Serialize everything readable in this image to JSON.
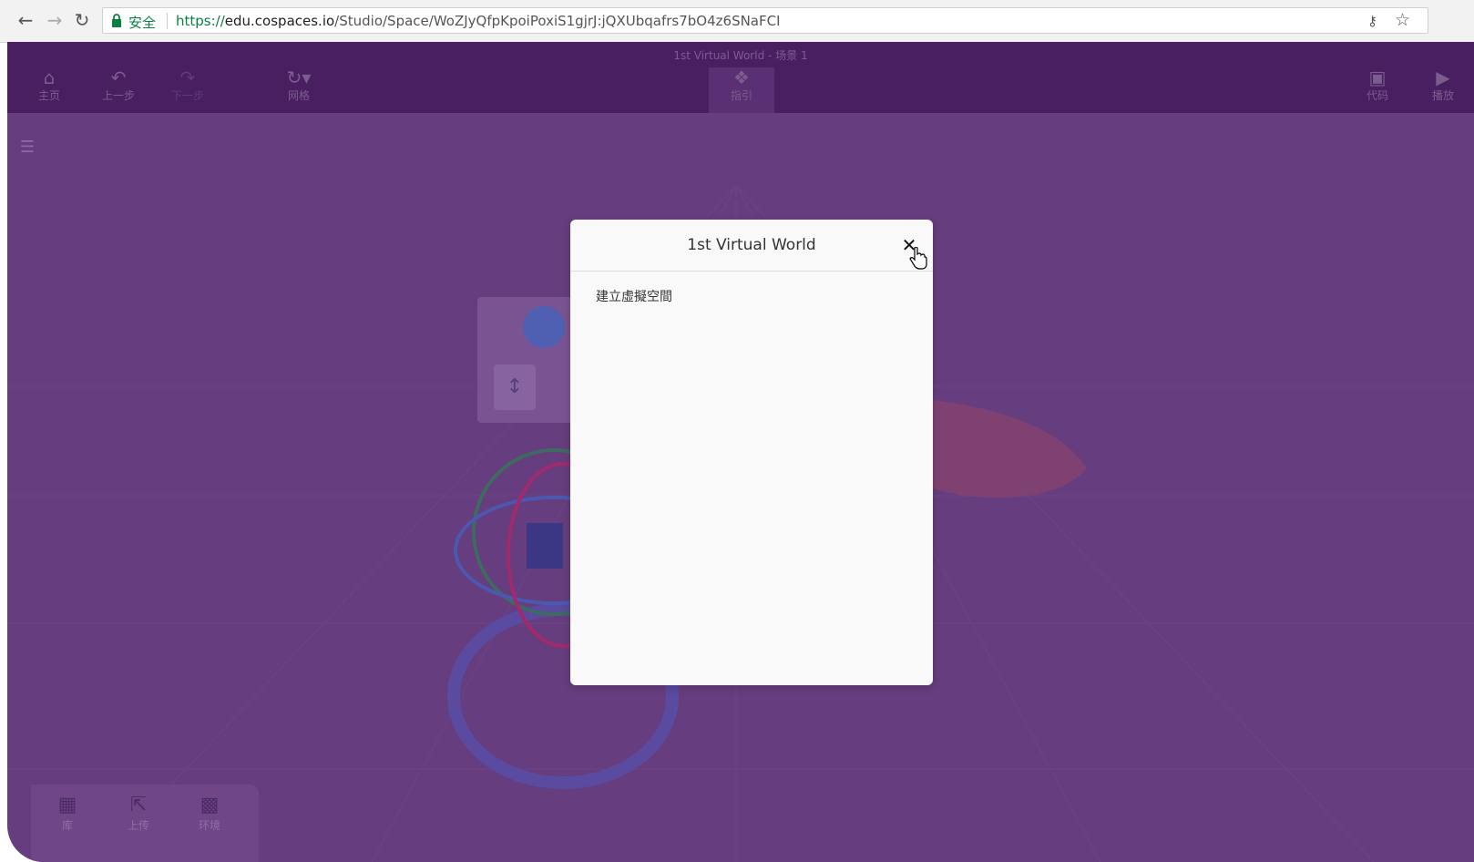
{
  "browser": {
    "secure_label": "安全",
    "url_scheme": "https://",
    "url_host": "edu.cospaces.io",
    "url_path": "/Studio/Space/WoZJyQfpKpoiPoxiS1gjrJ:jQXUbqafrs7bO4z6SNaFCI"
  },
  "toolbar": {
    "doc_title": "1st Virtual World - 场景 1",
    "home_label": "主页",
    "undo_label": "上一步",
    "redo_label": "下一步",
    "grid_label": "网格",
    "guide_label": "指引",
    "code_label": "代码",
    "play_label": "播放"
  },
  "bottom_panel": {
    "library_label": "库",
    "upload_label": "上传",
    "environment_label": "环境"
  },
  "modal": {
    "title": "1st Virtual World",
    "close_glyph": "✕",
    "body_text": "建立虛擬空間"
  },
  "colors": {
    "toolbar_bg": "#4a1f62",
    "scene_bg": "#663d7e",
    "secure_green": "#0b8043"
  }
}
